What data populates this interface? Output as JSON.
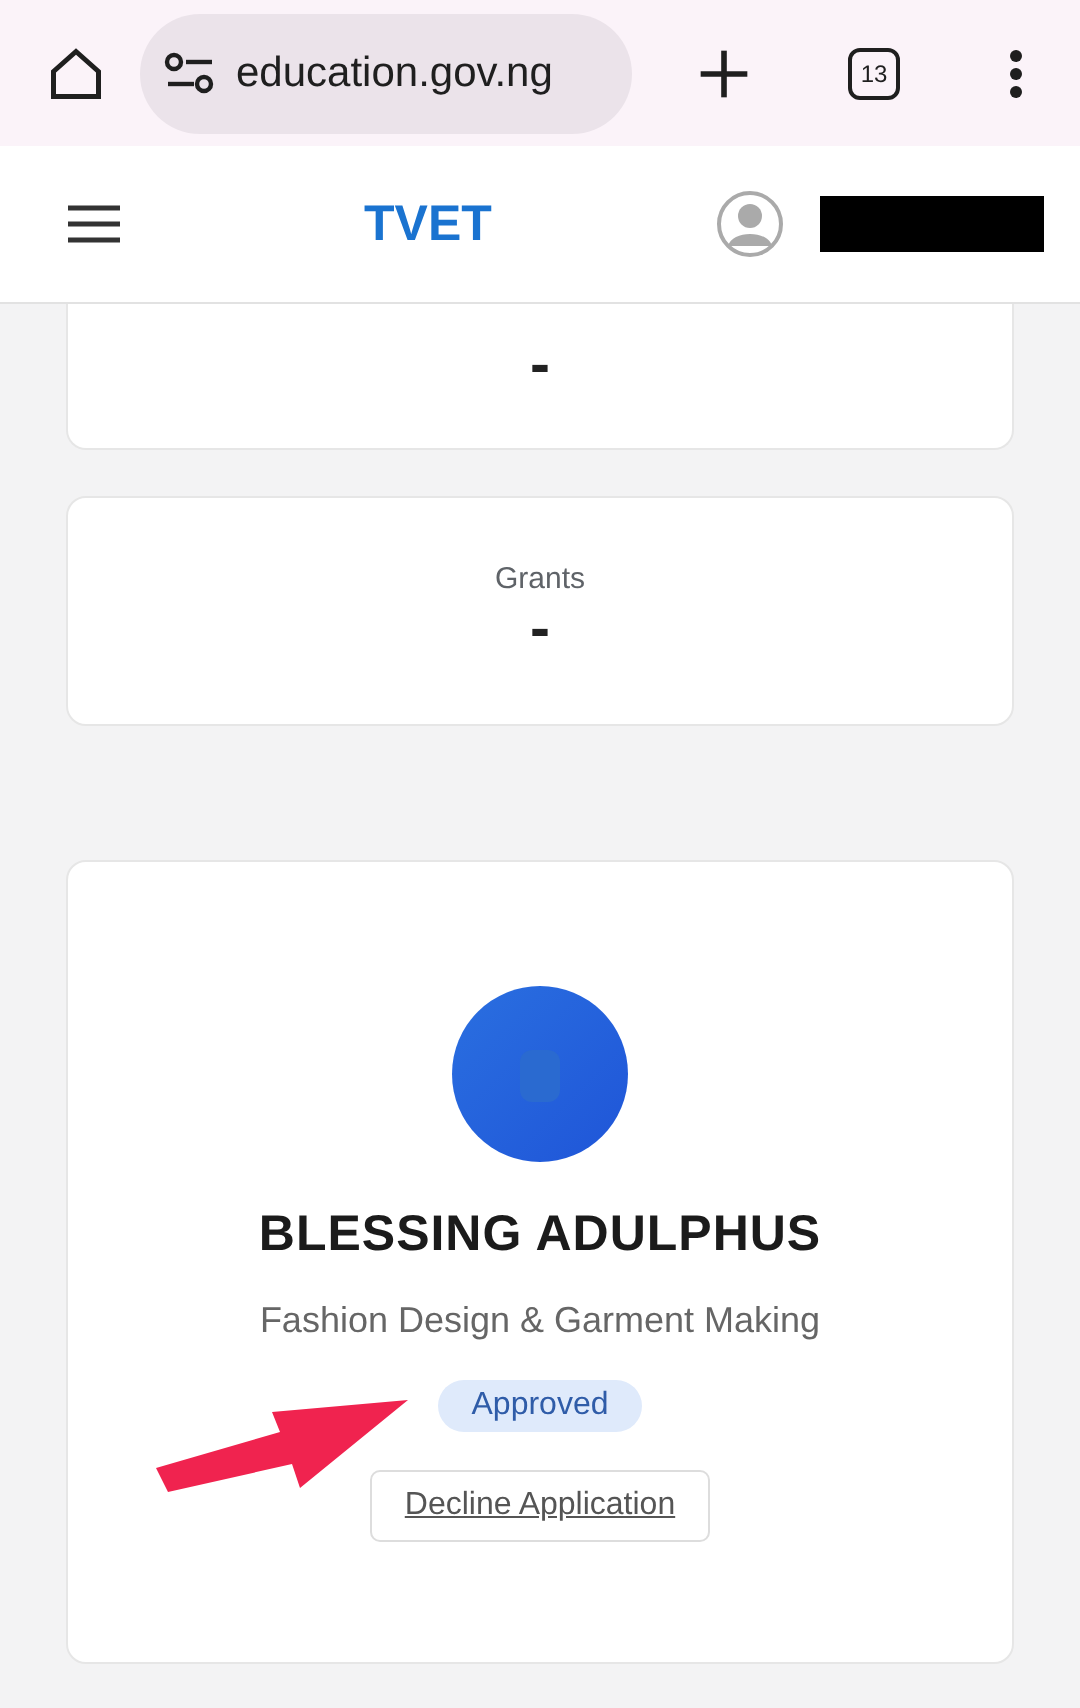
{
  "browser": {
    "url": "education.gov.ng",
    "tab_count": "13"
  },
  "header": {
    "logo": "TVET"
  },
  "stats": [
    {
      "value": "-"
    },
    {
      "label": "Grants",
      "value": "-"
    }
  ],
  "profile": {
    "name": "BLESSING ADULPHUS",
    "course": "Fashion Design & Garment Making",
    "status": {
      "text": "Approved",
      "approved": true
    },
    "action": "Decline Application"
  }
}
